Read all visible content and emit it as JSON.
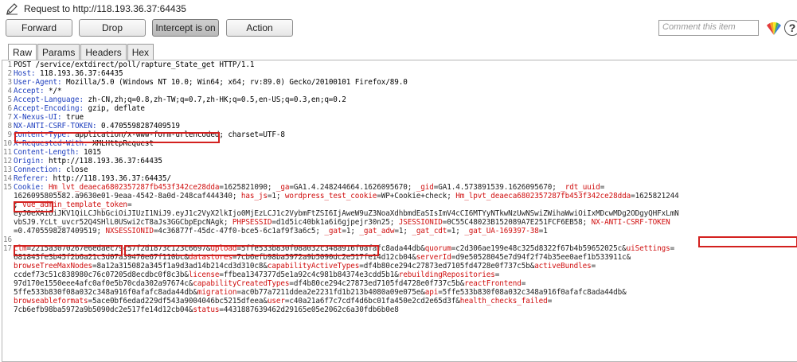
{
  "window": {
    "title": "Request to http://118.193.36.37:64435"
  },
  "toolbar": {
    "forward": "Forward",
    "drop": "Drop",
    "intercept": "Intercept is on",
    "action": "Action",
    "comment_placeholder": "Comment this item",
    "help": "?"
  },
  "tabs": [
    "Raw",
    "Params",
    "Headers",
    "Hex"
  ],
  "request_lines": [
    {
      "n": "1",
      "segs": [
        {
          "t": "v",
          "s": "POST /service/extdirect/poll/rapture_State_get HTTP/1.1"
        }
      ]
    },
    {
      "n": "2",
      "segs": [
        {
          "t": "k",
          "s": "Host:"
        },
        {
          "t": "v",
          "s": " 118.193.36.37:64435"
        }
      ]
    },
    {
      "n": "3",
      "segs": [
        {
          "t": "k",
          "s": "User-Agent:"
        },
        {
          "t": "v",
          "s": " Mozilla/5.0 (Windows NT 10.0; Win64; x64; rv:89.0) Gecko/20100101 Firefox/89.0"
        }
      ]
    },
    {
      "n": "4",
      "segs": [
        {
          "t": "k",
          "s": "Accept:"
        },
        {
          "t": "v",
          "s": " */*"
        }
      ]
    },
    {
      "n": "5",
      "segs": [
        {
          "t": "k",
          "s": "Accept-Language:"
        },
        {
          "t": "v",
          "s": " zh-CN,zh;q=0.8,zh-TW;q=0.7,zh-HK;q=0.5,en-US;q=0.3,en;q=0.2"
        }
      ]
    },
    {
      "n": "6",
      "segs": [
        {
          "t": "k",
          "s": "Accept-Encoding:"
        },
        {
          "t": "v",
          "s": " gzip, deflate"
        }
      ]
    },
    {
      "n": "7",
      "segs": [
        {
          "t": "k",
          "s": "X-Nexus-UI:"
        },
        {
          "t": "v",
          "s": " true"
        }
      ]
    },
    {
      "n": "8",
      "segs": [
        {
          "t": "k",
          "s": "NX-ANTI-CSRF-TOKEN:"
        },
        {
          "t": "v",
          "s": " 0.4705598287409519"
        }
      ]
    },
    {
      "n": "9",
      "segs": [
        {
          "t": "k",
          "s": "Content-Type:"
        },
        {
          "t": "v",
          "s": " application/x-www-form-urlencoded; charset=UTF-8"
        }
      ]
    },
    {
      "n": "10",
      "segs": [
        {
          "t": "k",
          "s": "X-Requested-With:"
        },
        {
          "t": "v",
          "s": " XMLHttpRequest"
        }
      ]
    },
    {
      "n": "11",
      "segs": [
        {
          "t": "k",
          "s": "Content-Length:"
        },
        {
          "t": "v",
          "s": " 1015"
        }
      ]
    },
    {
      "n": "12",
      "segs": [
        {
          "t": "k",
          "s": "Origin:"
        },
        {
          "t": "v",
          "s": " http://118.193.36.37:64435"
        }
      ]
    },
    {
      "n": "13",
      "segs": [
        {
          "t": "k",
          "s": "Connection:"
        },
        {
          "t": "v",
          "s": " close"
        }
      ]
    },
    {
      "n": "14",
      "segs": [
        {
          "t": "k",
          "s": "Referer:"
        },
        {
          "t": "v",
          "s": " http://118.193.36.37:64435/"
        }
      ]
    },
    {
      "n": "15",
      "segs": [
        {
          "t": "k",
          "s": "Cookie:"
        },
        {
          "t": "v",
          "s": " "
        },
        {
          "t": "c",
          "s": "Hm_lvt_deaeca6802357287fb453f342ce28dda"
        },
        {
          "t": "cv",
          "s": "=1625821090; "
        },
        {
          "t": "c",
          "s": "_ga"
        },
        {
          "t": "cv",
          "s": "=GA1.4.248244664.1626095670; "
        },
        {
          "t": "c",
          "s": "_gid"
        },
        {
          "t": "cv",
          "s": "=GA1.4.573891539.1626095670; "
        },
        {
          "t": "c",
          "s": "_rdt_uuid"
        },
        {
          "t": "cv",
          "s": "="
        }
      ]
    },
    {
      "n": "",
      "segs": [
        {
          "t": "cv",
          "s": "1626095805582.a9630e01-9eaa-4542-8a0d-248caf444340; "
        },
        {
          "t": "c",
          "s": "has_js"
        },
        {
          "t": "cv",
          "s": "=1; "
        },
        {
          "t": "c",
          "s": "wordpress_test_cookie"
        },
        {
          "t": "cv",
          "s": "=WP+Cookie+check; "
        },
        {
          "t": "c",
          "s": "Hm_lpvt_deaeca6802357287fb453f342ce28dda"
        },
        {
          "t": "cv",
          "s": "=1625821244"
        }
      ]
    },
    {
      "n": "",
      "segs": [
        {
          "t": "cv",
          "s": "; "
        },
        {
          "t": "c",
          "s": "vue_admin_template_token"
        },
        {
          "t": "cv",
          "s": "="
        }
      ]
    },
    {
      "n": "",
      "segs": [
        {
          "t": "cv",
          "s": "eyJ0eXAiOiJKV1QiLCJhbGciOiJIUzI1NiJ9.eyJ1c2VyX2lkIjo0MjEzLCJ1c2VybmFtZSI6IjAweW9uZ3NoaXdhbmdEaSIsImV4cCI6MTYyNTkwNzUwNSwiZWihaWwiOiIxMDcwMDg2ODgyQHFxLmN"
        }
      ]
    },
    {
      "n": "",
      "segs": [
        {
          "t": "cv",
          "s": "vbSJ9.YcLt_uvcr52Q4SHlL0USwi2cT8aJs3GGCbpEpcNAgk; "
        },
        {
          "t": "c",
          "s": "PHPSESSID"
        },
        {
          "t": "cv",
          "s": "=d1d5ic40bk1a6i6gjpejr30n25; "
        },
        {
          "t": "c",
          "s": "JSESSIONID"
        },
        {
          "t": "cv",
          "s": "=0C55C48023B152089A7E251FCF6EB58; "
        },
        {
          "t": "c",
          "s": "NX-ANTI-CSRF-TOKEN"
        }
      ]
    },
    {
      "n": "",
      "segs": [
        {
          "t": "cv",
          "s": "=0.4705598287409519; "
        },
        {
          "t": "c",
          "s": "NXSESSIONID"
        },
        {
          "t": "cv",
          "s": "=4c36877f-45dc-47f0-bce5-6c1af9f3a6c5; "
        },
        {
          "t": "c",
          "s": "_gat"
        },
        {
          "t": "cv",
          "s": "=1; "
        },
        {
          "t": "c",
          "s": "_gat_adw"
        },
        {
          "t": "cv",
          "s": "=1; "
        },
        {
          "t": "c",
          "s": "_gat_cdt"
        },
        {
          "t": "cv",
          "s": "=1; "
        },
        {
          "t": "c",
          "s": "_gat_UA-169397-38"
        },
        {
          "t": "cv",
          "s": "=1"
        }
      ]
    },
    {
      "n": "16",
      "segs": [
        {
          "t": "v",
          "s": ""
        }
      ]
    },
    {
      "n": "17",
      "segs": [
        {
          "t": "c",
          "s": "clm"
        },
        {
          "t": "cv",
          "s": "=2215a3070267e6edaec79c57f2d1873c123c6697&"
        },
        {
          "t": "c",
          "s": "upload"
        },
        {
          "t": "cv",
          "s": "=5ffe533b830f08a032c348a916f0afafc8ada44db&"
        },
        {
          "t": "c",
          "s": "quorum"
        },
        {
          "t": "cv",
          "s": "=c2d306ae199e48c325d8322f67b4b59652025c&"
        },
        {
          "t": "c",
          "s": "uiSettings"
        },
        {
          "t": "cv",
          "s": "="
        }
      ]
    },
    {
      "n": "",
      "segs": [
        {
          "t": "cv",
          "s": "681843fe3b45f2b6a21c3d07a39470e67f110bc&"
        },
        {
          "t": "c",
          "s": "datastores"
        },
        {
          "t": "cv",
          "s": "=7cb6efb98ba5972a9b5090dc2e517fe14d12cb04&"
        },
        {
          "t": "c",
          "s": "serverId"
        },
        {
          "t": "cv",
          "s": "=d9e50528045e7d94f2f74b35ee0aef1b533911c&"
        }
      ]
    },
    {
      "n": "",
      "segs": [
        {
          "t": "c",
          "s": "browseTreeMaxNodes"
        },
        {
          "t": "cv",
          "s": "=8a12a315082a345f1a9d3ad14b214cd3d310c8&"
        },
        {
          "t": "c",
          "s": "capabilityActiveTypes"
        },
        {
          "t": "cv",
          "s": "=df4b80ce294c27873ed7105fd4728e0f737c5b&"
        },
        {
          "t": "c",
          "s": "activeBundles"
        },
        {
          "t": "cv",
          "s": "="
        }
      ]
    },
    {
      "n": "",
      "segs": [
        {
          "t": "cv",
          "s": "ccdef73c51c838980c76c07205d8ecdbc0f8c3b&"
        },
        {
          "t": "c",
          "s": "license"
        },
        {
          "t": "cv",
          "s": "=ffbea1347377d5e1a92c4c981b84374e3cdd5b1&"
        },
        {
          "t": "c",
          "s": "rebuildingRepositories"
        },
        {
          "t": "cv",
          "s": "="
        }
      ]
    },
    {
      "n": "",
      "segs": [
        {
          "t": "cv",
          "s": "97d170e1550eee4afc0af0e5b70cda302a97674c&"
        },
        {
          "t": "c",
          "s": "capabilityCreatedTypes"
        },
        {
          "t": "cv",
          "s": "=df4b80ce294c27873ed7105fd4728e0f737c5b&"
        },
        {
          "t": "c",
          "s": "reactFrontend"
        },
        {
          "t": "cv",
          "s": "="
        }
      ]
    },
    {
      "n": "",
      "segs": [
        {
          "t": "cv",
          "s": "5ffe533b830f08a032c348a916f0afafc8ada44db&"
        },
        {
          "t": "c",
          "s": "migration"
        },
        {
          "t": "cv",
          "s": "=ac0b77a7211ddea2e2231fd1b213b4080a09e075e&"
        },
        {
          "t": "c",
          "s": "api"
        },
        {
          "t": "cv",
          "s": "=5ffe533b830f08a032c348a916f0afafc8ada44db&"
        }
      ]
    },
    {
      "n": "",
      "segs": [
        {
          "t": "c",
          "s": "browseableformats"
        },
        {
          "t": "cv",
          "s": "=5ace0bf6edad229df543a9004046bc5215dfeea&"
        },
        {
          "t": "c",
          "s": "user"
        },
        {
          "t": "cv",
          "s": "=c40a21a6f7c7cdf4d6bc01fa450e2cd2e65d3f&"
        },
        {
          "t": "c",
          "s": "health_checks_failed"
        },
        {
          "t": "cv",
          "s": "="
        }
      ]
    },
    {
      "n": "",
      "segs": [
        {
          "t": "cv",
          "s": "7cb6efb98ba5972a9b5090dc2e517fe14d12cb04&"
        },
        {
          "t": "c",
          "s": "status"
        },
        {
          "t": "cv",
          "s": "=4431887639462d29165e05e2062c6a30fdb6b0e8"
        }
      ]
    }
  ]
}
